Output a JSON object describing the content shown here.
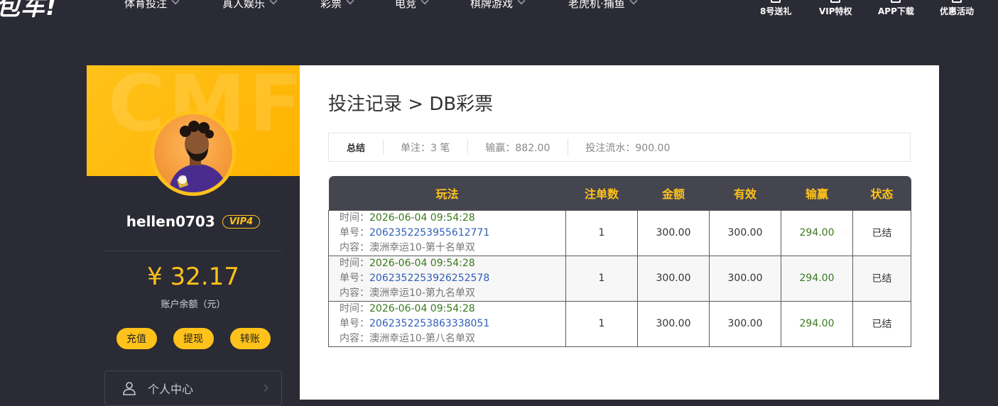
{
  "header": {
    "logo_text": "包车!",
    "nav": [
      {
        "label": "体育投注"
      },
      {
        "label": "真人娱乐"
      },
      {
        "label": "彩票"
      },
      {
        "label": "电竞"
      },
      {
        "label": "棋牌游戏"
      },
      {
        "label": "老虎机·捕鱼"
      }
    ],
    "tools": [
      {
        "label": "8号送礼"
      },
      {
        "label": "VIP特权"
      },
      {
        "label": "APP下载"
      },
      {
        "label": "优惠活动"
      }
    ]
  },
  "sidebar": {
    "watermark": "CMF",
    "username": "hellen0703",
    "vip": "VIP4",
    "balance": "¥ 32.17",
    "balance_label": "账户余额（元）",
    "actions": [
      {
        "label": "充值"
      },
      {
        "label": "提现"
      },
      {
        "label": "转账"
      }
    ],
    "menu": [
      {
        "label": "个人中心",
        "icon": "user-icon"
      }
    ]
  },
  "main": {
    "title": "投注记录 > DB彩票",
    "summary": {
      "title": "总结",
      "bets": "单注：3 笔",
      "winloss": "输赢：882.00",
      "turnover": "投注流水：900.00"
    },
    "table": {
      "columns": [
        "玩法",
        "注单数",
        "金额",
        "有效",
        "输赢",
        "状态"
      ],
      "labels": {
        "time": "时间：",
        "order": "单号：",
        "content": "内容："
      },
      "rows": [
        {
          "time": "2026-06-04 09:54:28",
          "order": "2062352253955612771",
          "content": "澳洲幸运10-第十名单双",
          "count": "1",
          "amount": "300.00",
          "valid": "300.00",
          "win": "294.00",
          "status": "已结"
        },
        {
          "time": "2026-06-04 09:54:28",
          "order": "2062352253926252578",
          "content": "澳洲幸运10-第九名单双",
          "count": "1",
          "amount": "300.00",
          "valid": "300.00",
          "win": "294.00",
          "status": "已结"
        },
        {
          "time": "2026-06-04 09:54:28",
          "order": "2062352253863338051",
          "content": "澳洲幸运10-第八名单双",
          "count": "1",
          "amount": "300.00",
          "valid": "300.00",
          "win": "294.00",
          "status": "已结"
        }
      ]
    }
  },
  "colors": {
    "accent": "#ffc21a",
    "dark_bg": "#2b2b35",
    "header_row": "#45454f",
    "win_green": "#3a7a1e",
    "link_blue": "#2f5fb8"
  }
}
